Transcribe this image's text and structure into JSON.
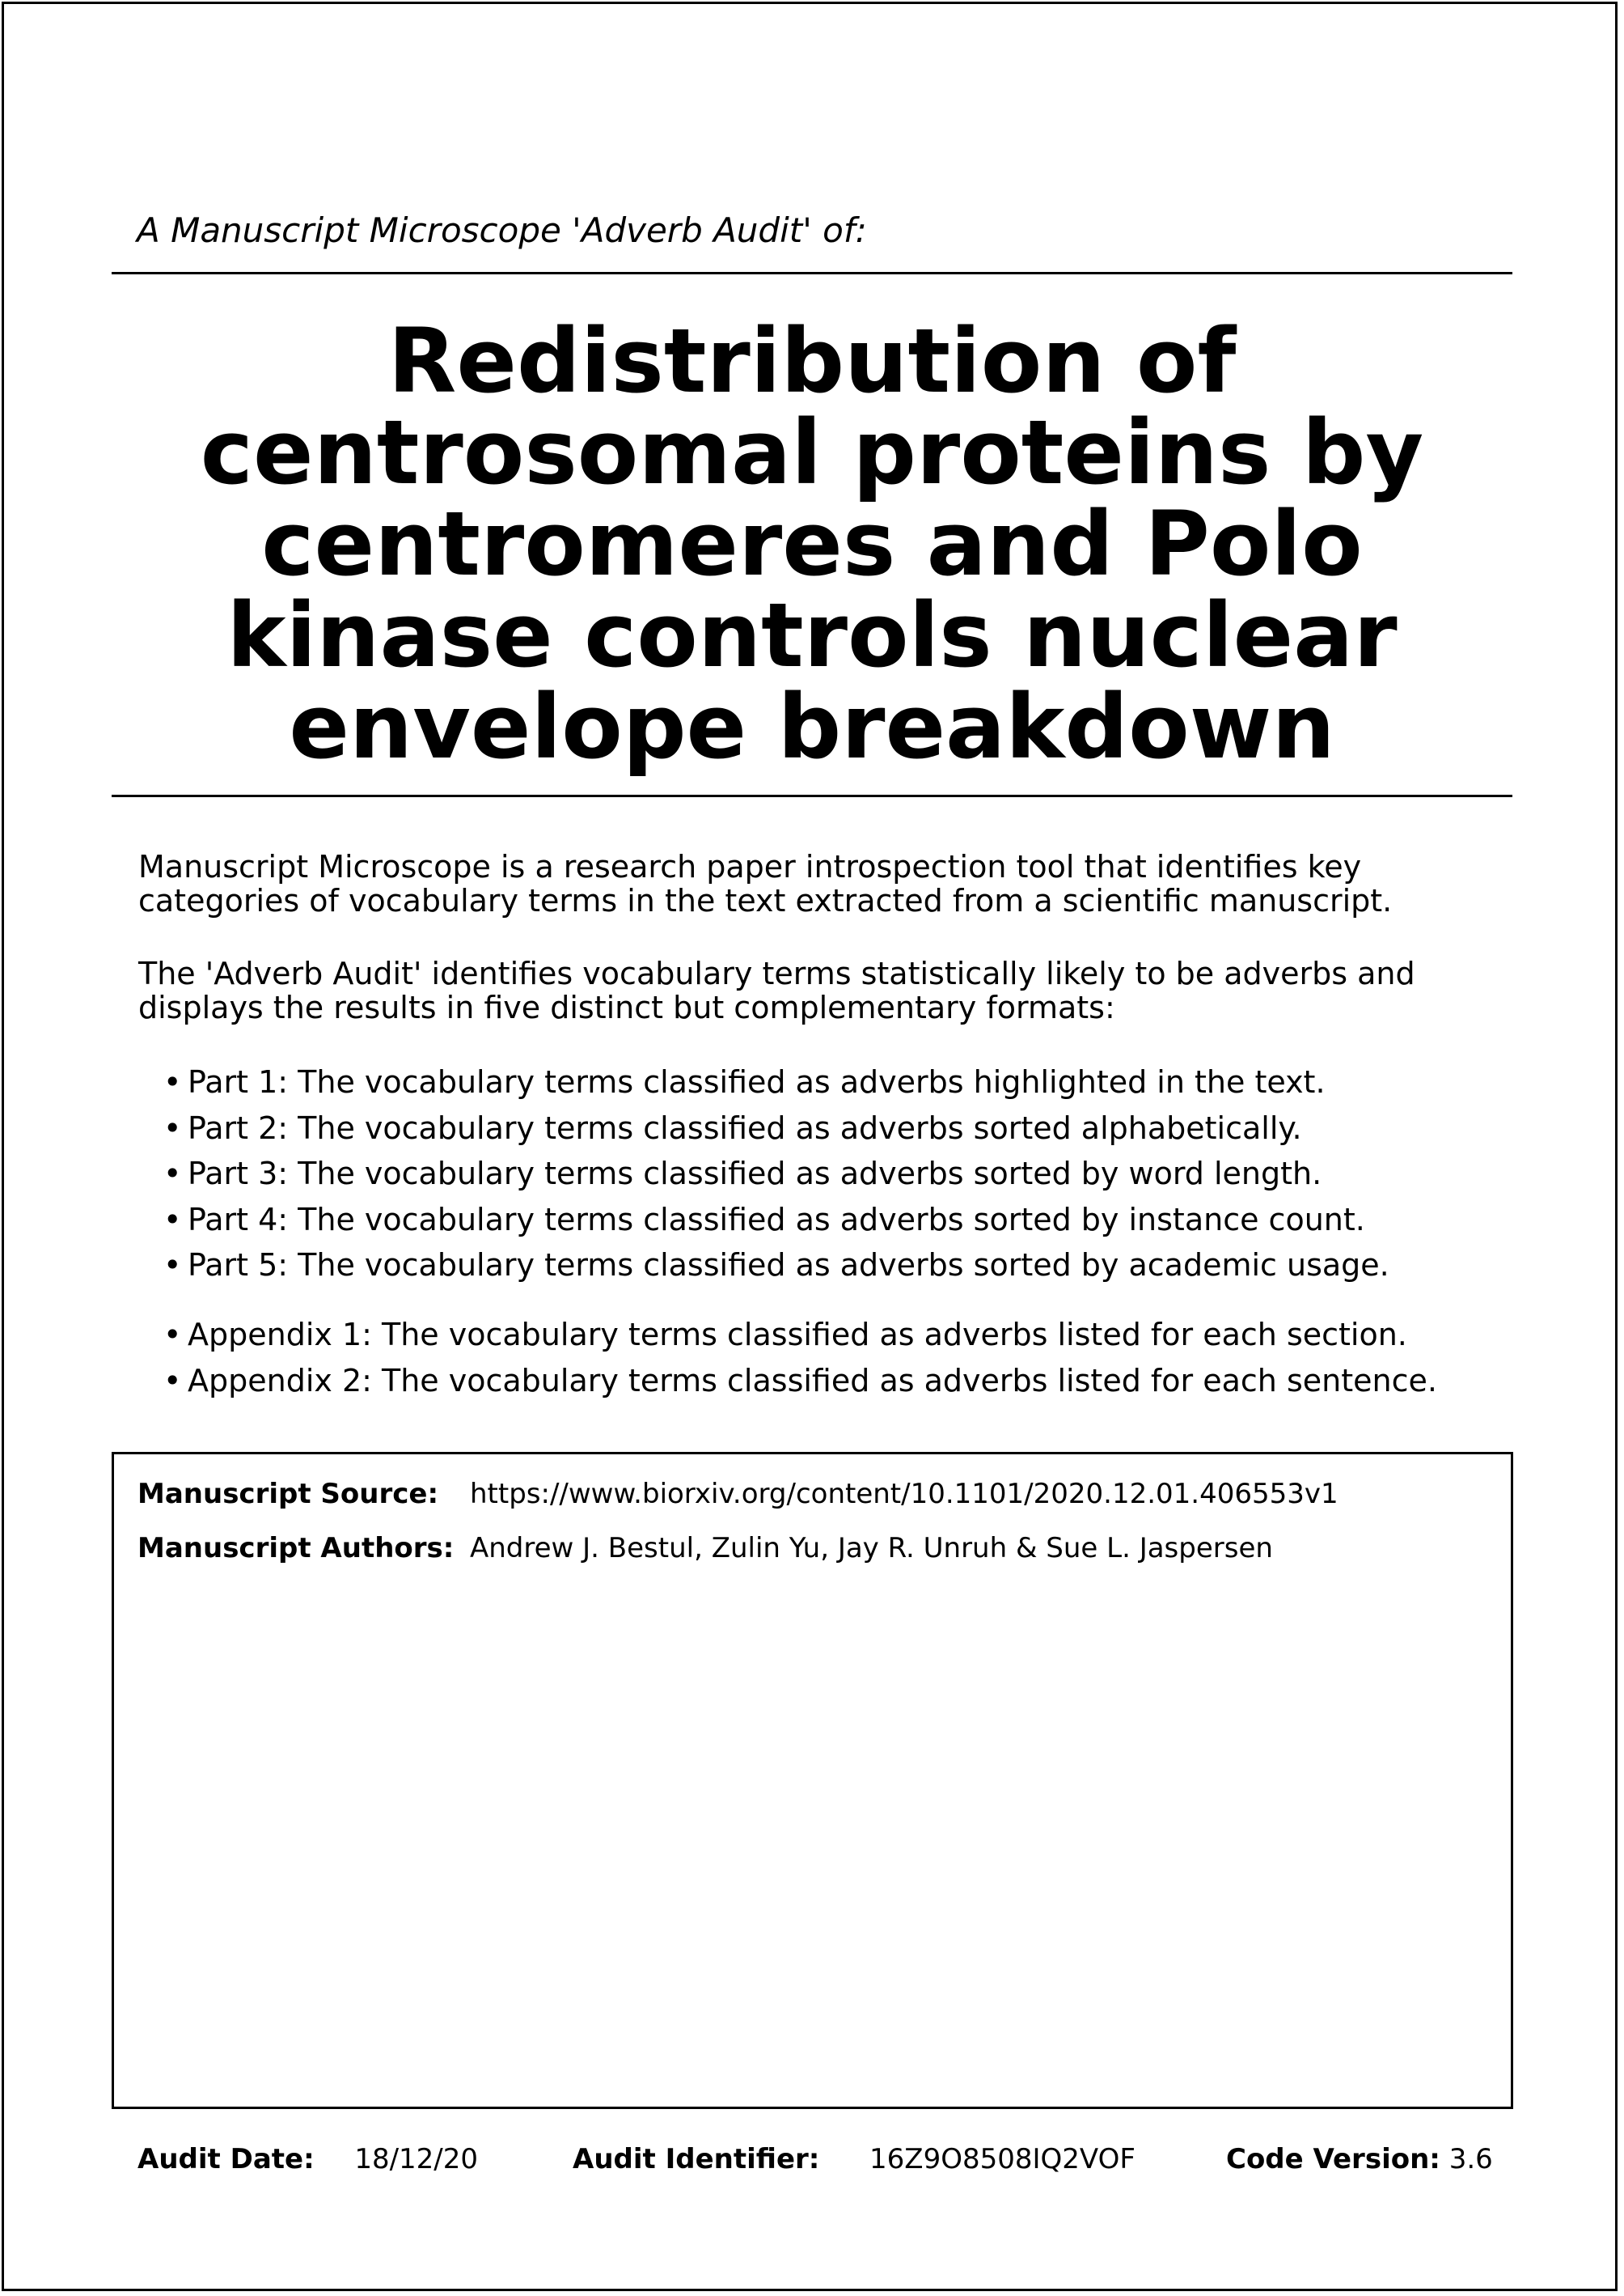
{
  "header": {
    "subtitle": "A Manuscript Microscope 'Adverb Audit' of:"
  },
  "title": {
    "lines": [
      "Redistribution of",
      "centrosomal proteins by",
      "centromeres and Polo",
      "kinase controls nuclear",
      "envelope breakdown"
    ]
  },
  "intro": {
    "paragraph1": [
      "Manuscript Microscope is a research paper introspection tool that identifies key",
      "categories of vocabulary terms in the text extracted from a scientific manuscript."
    ],
    "paragraph2": [
      "The 'Adverb Audit' identifies vocabulary terms statistically likely to be adverbs and",
      "displays the results in five distinct but complementary formats:"
    ]
  },
  "parts": [
    "Part 1: The vocabulary terms classified as adverbs highlighted in the text.",
    "Part 2: The vocabulary terms classified as adverbs sorted alphabetically.",
    "Part 3: The vocabulary terms classified as adverbs sorted by word length.",
    "Part 4: The vocabulary terms classified as adverbs sorted by instance count.",
    "Part 5: The vocabulary terms classified as adverbs sorted by academic usage."
  ],
  "appendices": [
    "Appendix 1: The vocabulary terms classified as adverbs listed for each section.",
    "Appendix 2: The vocabulary terms classified as adverbs listed for each sentence."
  ],
  "bullet": "•",
  "manuscript": {
    "source_label": "Manuscript Source:",
    "source_value": "https://www.biorxiv.org/content/10.1101/2020.12.01.406553v1",
    "authors_label": "Manuscript Authors:",
    "authors_value": "Andrew J. Bestul, Zulin Yu, Jay R. Unruh & Sue L. Jaspersen"
  },
  "footer": {
    "audit_date_label": "Audit Date:",
    "audit_date_value": "18/12/20",
    "audit_id_label": "Audit Identifier:",
    "audit_id_value": "16Z9O8508IQ2VOF",
    "code_version_label": "Code Version:",
    "code_version_value": "3.6"
  }
}
